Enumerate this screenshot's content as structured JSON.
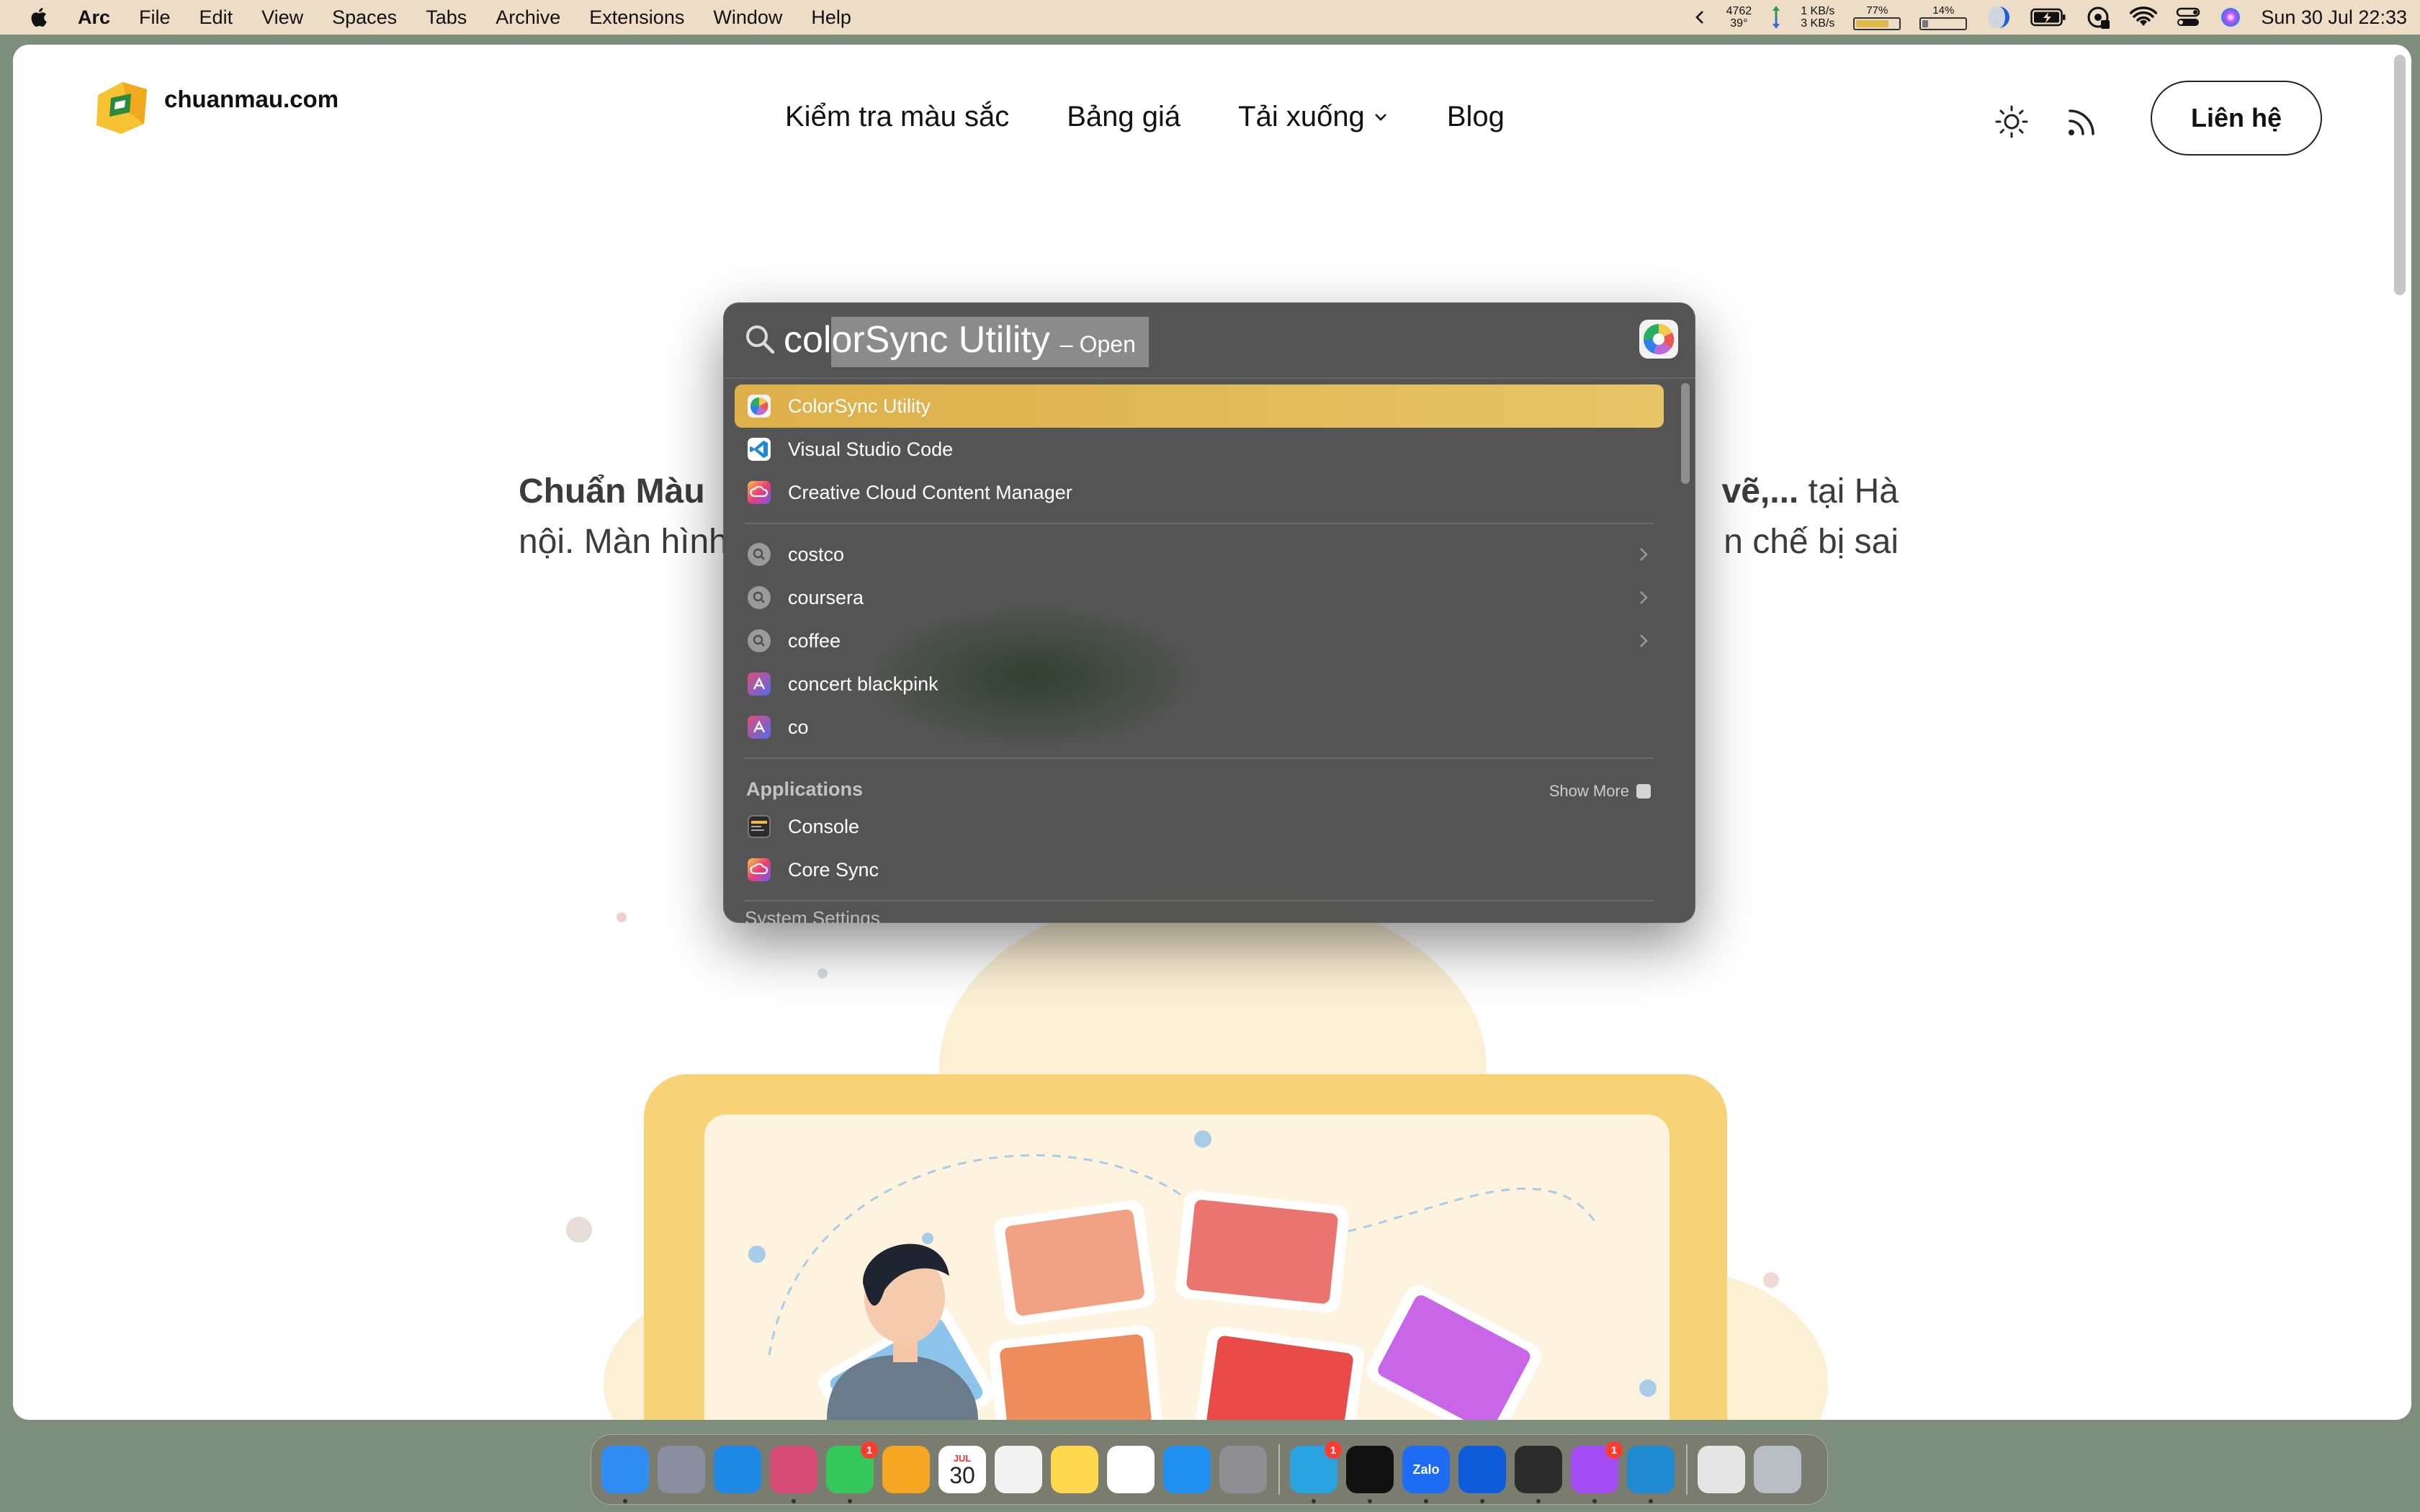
{
  "menubar": {
    "app_name": "Arc",
    "menus": [
      "File",
      "Edit",
      "View",
      "Spaces",
      "Tabs",
      "Archive",
      "Extensions",
      "Window",
      "Help"
    ],
    "status": {
      "cpu_top": "4762",
      "cpu_bottom": "39°",
      "net_up": "1 KB/s",
      "net_down": "3 KB/s",
      "mem_pct": "77%",
      "mem_fraction": 0.77,
      "disk_pct": "14%",
      "disk_fraction": 0.14,
      "datetime": "Sun 30 Jul  22:33"
    }
  },
  "site": {
    "logo_text": "chuanmau.com",
    "nav": [
      {
        "label": "Kiểm tra màu sắc"
      },
      {
        "label": "Bảng giá"
      },
      {
        "label": "Tải xuống",
        "dropdown": true
      },
      {
        "label": "Blog"
      }
    ],
    "contact_label": "Liên hệ",
    "hero_line1_bold_a": "Chuẩn Màu",
    "hero_line1_bold_b": "vẽ,...",
    "hero_line1_tail": " tại Hà",
    "hero_line2_a": "nội. Màn hình",
    "hero_line2_b": "n chế bị sai"
  },
  "spotlight": {
    "query_typed": "col",
    "query_completion": "orSync Utility",
    "open_hint": "– Open",
    "top_hits": [
      {
        "label": "ColorSync Utility",
        "icon": "colorsync-icon",
        "selected": true
      },
      {
        "label": "Visual Studio Code",
        "icon": "vscode-icon"
      },
      {
        "label": "Creative Cloud Content Manager",
        "icon": "creative-cloud-icon"
      }
    ],
    "suggestions": [
      {
        "label": "costco",
        "icon": "search-suggestion-icon",
        "chevron": true
      },
      {
        "label": "coursera",
        "icon": "search-suggestion-icon",
        "chevron": true
      },
      {
        "label": "coffee",
        "icon": "search-suggestion-icon",
        "chevron": true
      },
      {
        "label": "concert blackpink",
        "icon": "web-history-icon"
      },
      {
        "label": "co",
        "icon": "web-history-icon"
      }
    ],
    "applications_title": "Applications",
    "show_more": "Show More",
    "applications": [
      {
        "label": "Console",
        "icon": "console-icon"
      },
      {
        "label": "Core Sync",
        "icon": "core-sync-icon"
      }
    ],
    "cut_off_section": "System Settings"
  },
  "dock": {
    "apps": [
      {
        "name": "finder-icon",
        "color": "#2f8cf0",
        "dot": true
      },
      {
        "name": "launchpad-icon",
        "color": "#8a8fa0"
      },
      {
        "name": "safari-icon",
        "color": "#1e88e5"
      },
      {
        "name": "arc-icon",
        "color": "#d84c78",
        "dot": true
      },
      {
        "name": "messages-icon",
        "color": "#34c759",
        "badge": "1",
        "dot": true
      },
      {
        "name": "photos-icon",
        "color": "#f5a623"
      },
      {
        "name": "calendar-icon",
        "color": "#ffffff",
        "month": "JUL",
        "day": "30"
      },
      {
        "name": "reminders-icon",
        "color": "#f2f2f2"
      },
      {
        "name": "notes-icon",
        "color": "#ffd84d"
      },
      {
        "name": "freeform-icon",
        "color": "#ffffff"
      },
      {
        "name": "app-store-icon",
        "color": "#1f8ef1"
      },
      {
        "name": "system-settings-icon",
        "color": "#8e8e93"
      }
    ],
    "apps2": [
      {
        "name": "telegram-icon",
        "color": "#2aa4e0",
        "badge": "1",
        "dot": true
      },
      {
        "name": "news-icon",
        "color": "#111111",
        "dot": true
      },
      {
        "name": "zalo-icon",
        "color": "#1e6cf4",
        "label": "Zalo",
        "dot": true
      },
      {
        "name": "teamviewer-icon",
        "color": "#0e5cd9",
        "dot": true
      },
      {
        "name": "netflix-bar-icon",
        "color": "#2b2b2b",
        "dot": true
      },
      {
        "name": "messenger-icon",
        "color": "#a34cf4",
        "badge": "1",
        "dot": true
      },
      {
        "name": "vscode-dock-icon",
        "color": "#1f8ad2",
        "dot": true
      }
    ],
    "trailing": [
      {
        "name": "documents-stack-icon",
        "color": "#e6e6e6"
      },
      {
        "name": "trash-icon",
        "color": "#b9bec4"
      }
    ]
  }
}
